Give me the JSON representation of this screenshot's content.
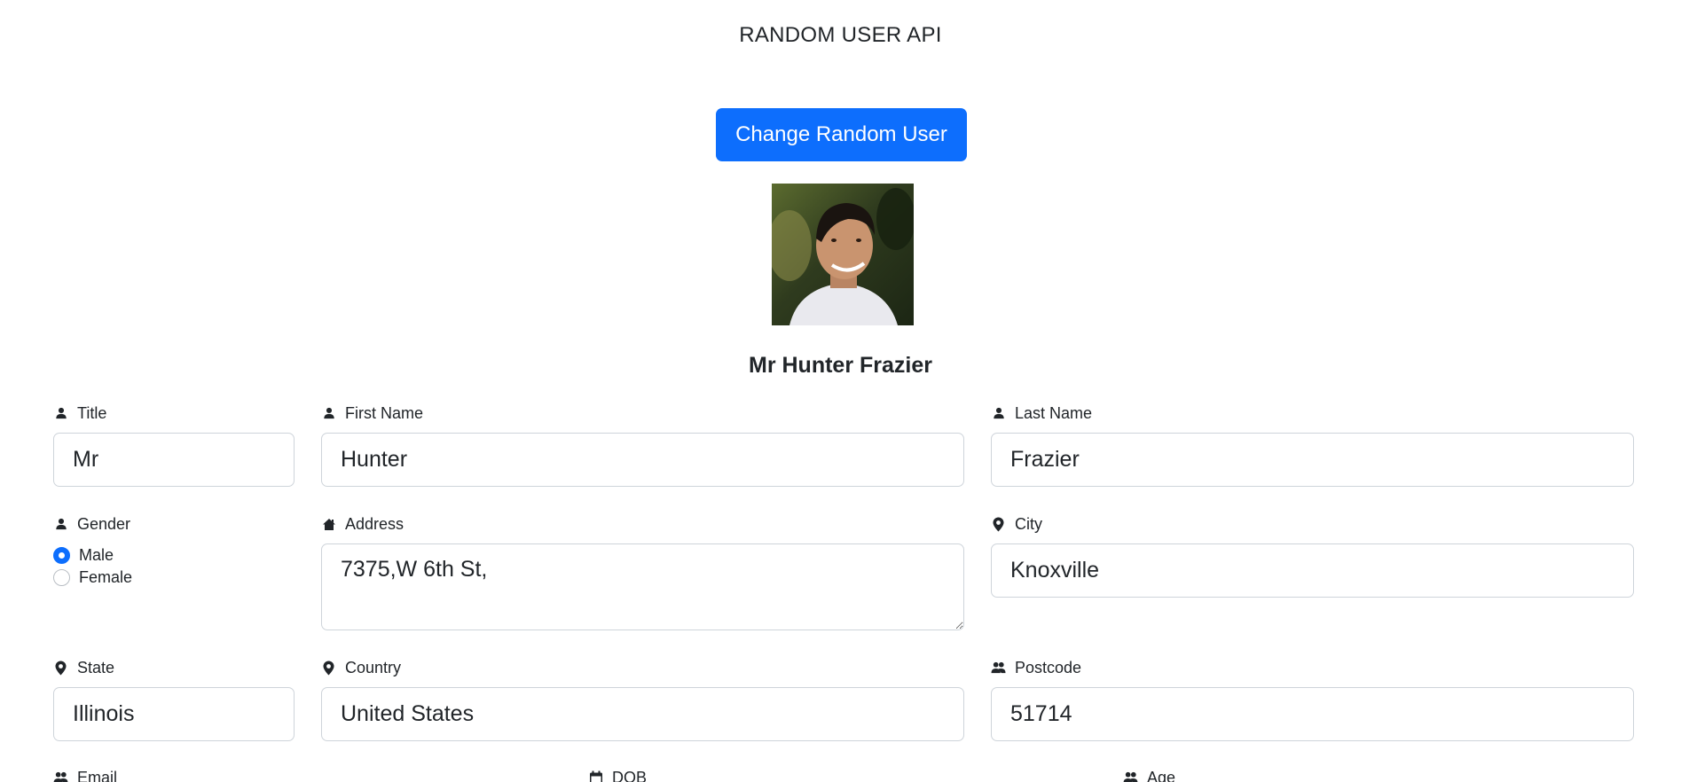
{
  "header": {
    "title": "RANDOM USER API"
  },
  "actions": {
    "change_user_label": "Change Random User"
  },
  "profile": {
    "full_name": "Mr Hunter Frazier"
  },
  "form": {
    "title": {
      "label": "Title",
      "value": "Mr",
      "icon": "person-icon"
    },
    "first_name": {
      "label": "First Name",
      "value": "Hunter",
      "icon": "person-icon"
    },
    "last_name": {
      "label": "Last Name",
      "value": "Frazier",
      "icon": "person-icon"
    },
    "gender": {
      "label": "Gender",
      "icon": "person-icon",
      "options": [
        "Male",
        "Female"
      ],
      "selected": "Male"
    },
    "address": {
      "label": "Address",
      "value": "7375,W 6th St,",
      "icon": "house-icon"
    },
    "city": {
      "label": "City",
      "value": "Knoxville",
      "icon": "map-pin-icon"
    },
    "state": {
      "label": "State",
      "value": "Illinois",
      "icon": "map-pin-icon"
    },
    "country": {
      "label": "Country",
      "value": "United States",
      "icon": "map-pin-icon"
    },
    "postcode": {
      "label": "Postcode",
      "value": "51714",
      "icon": "people-icon"
    },
    "email": {
      "label": "Email",
      "icon": "people-icon"
    },
    "dob": {
      "label": "DOB",
      "icon": "calendar-icon"
    },
    "age": {
      "label": "Age",
      "icon": "people-icon"
    }
  },
  "colors": {
    "primary": "#0d6efd",
    "text": "#212529",
    "border": "#ced4da"
  }
}
